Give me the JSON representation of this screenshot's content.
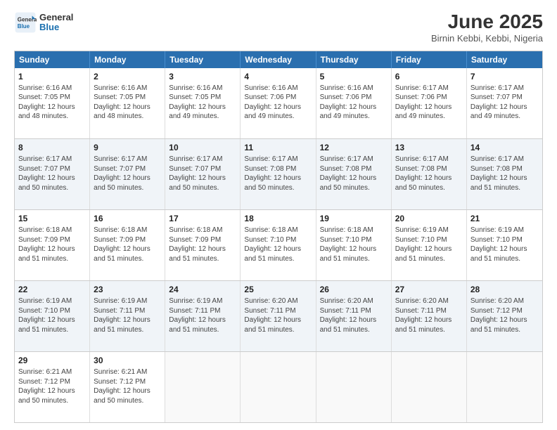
{
  "header": {
    "logo_line1": "General",
    "logo_line2": "Blue",
    "month": "June 2025",
    "location": "Birnin Kebbi, Kebbi, Nigeria"
  },
  "weekdays": [
    "Sunday",
    "Monday",
    "Tuesday",
    "Wednesday",
    "Thursday",
    "Friday",
    "Saturday"
  ],
  "rows": [
    [
      {
        "day": "1",
        "lines": [
          "Sunrise: 6:16 AM",
          "Sunset: 7:05 PM",
          "Daylight: 12 hours",
          "and 48 minutes."
        ]
      },
      {
        "day": "2",
        "lines": [
          "Sunrise: 6:16 AM",
          "Sunset: 7:05 PM",
          "Daylight: 12 hours",
          "and 48 minutes."
        ]
      },
      {
        "day": "3",
        "lines": [
          "Sunrise: 6:16 AM",
          "Sunset: 7:05 PM",
          "Daylight: 12 hours",
          "and 49 minutes."
        ]
      },
      {
        "day": "4",
        "lines": [
          "Sunrise: 6:16 AM",
          "Sunset: 7:06 PM",
          "Daylight: 12 hours",
          "and 49 minutes."
        ]
      },
      {
        "day": "5",
        "lines": [
          "Sunrise: 6:16 AM",
          "Sunset: 7:06 PM",
          "Daylight: 12 hours",
          "and 49 minutes."
        ]
      },
      {
        "day": "6",
        "lines": [
          "Sunrise: 6:17 AM",
          "Sunset: 7:06 PM",
          "Daylight: 12 hours",
          "and 49 minutes."
        ]
      },
      {
        "day": "7",
        "lines": [
          "Sunrise: 6:17 AM",
          "Sunset: 7:07 PM",
          "Daylight: 12 hours",
          "and 49 minutes."
        ]
      }
    ],
    [
      {
        "day": "8",
        "lines": [
          "Sunrise: 6:17 AM",
          "Sunset: 7:07 PM",
          "Daylight: 12 hours",
          "and 50 minutes."
        ]
      },
      {
        "day": "9",
        "lines": [
          "Sunrise: 6:17 AM",
          "Sunset: 7:07 PM",
          "Daylight: 12 hours",
          "and 50 minutes."
        ]
      },
      {
        "day": "10",
        "lines": [
          "Sunrise: 6:17 AM",
          "Sunset: 7:07 PM",
          "Daylight: 12 hours",
          "and 50 minutes."
        ]
      },
      {
        "day": "11",
        "lines": [
          "Sunrise: 6:17 AM",
          "Sunset: 7:08 PM",
          "Daylight: 12 hours",
          "and 50 minutes."
        ]
      },
      {
        "day": "12",
        "lines": [
          "Sunrise: 6:17 AM",
          "Sunset: 7:08 PM",
          "Daylight: 12 hours",
          "and 50 minutes."
        ]
      },
      {
        "day": "13",
        "lines": [
          "Sunrise: 6:17 AM",
          "Sunset: 7:08 PM",
          "Daylight: 12 hours",
          "and 50 minutes."
        ]
      },
      {
        "day": "14",
        "lines": [
          "Sunrise: 6:17 AM",
          "Sunset: 7:08 PM",
          "Daylight: 12 hours",
          "and 51 minutes."
        ]
      }
    ],
    [
      {
        "day": "15",
        "lines": [
          "Sunrise: 6:18 AM",
          "Sunset: 7:09 PM",
          "Daylight: 12 hours",
          "and 51 minutes."
        ]
      },
      {
        "day": "16",
        "lines": [
          "Sunrise: 6:18 AM",
          "Sunset: 7:09 PM",
          "Daylight: 12 hours",
          "and 51 minutes."
        ]
      },
      {
        "day": "17",
        "lines": [
          "Sunrise: 6:18 AM",
          "Sunset: 7:09 PM",
          "Daylight: 12 hours",
          "and 51 minutes."
        ]
      },
      {
        "day": "18",
        "lines": [
          "Sunrise: 6:18 AM",
          "Sunset: 7:10 PM",
          "Daylight: 12 hours",
          "and 51 minutes."
        ]
      },
      {
        "day": "19",
        "lines": [
          "Sunrise: 6:18 AM",
          "Sunset: 7:10 PM",
          "Daylight: 12 hours",
          "and 51 minutes."
        ]
      },
      {
        "day": "20",
        "lines": [
          "Sunrise: 6:19 AM",
          "Sunset: 7:10 PM",
          "Daylight: 12 hours",
          "and 51 minutes."
        ]
      },
      {
        "day": "21",
        "lines": [
          "Sunrise: 6:19 AM",
          "Sunset: 7:10 PM",
          "Daylight: 12 hours",
          "and 51 minutes."
        ]
      }
    ],
    [
      {
        "day": "22",
        "lines": [
          "Sunrise: 6:19 AM",
          "Sunset: 7:10 PM",
          "Daylight: 12 hours",
          "and 51 minutes."
        ]
      },
      {
        "day": "23",
        "lines": [
          "Sunrise: 6:19 AM",
          "Sunset: 7:11 PM",
          "Daylight: 12 hours",
          "and 51 minutes."
        ]
      },
      {
        "day": "24",
        "lines": [
          "Sunrise: 6:19 AM",
          "Sunset: 7:11 PM",
          "Daylight: 12 hours",
          "and 51 minutes."
        ]
      },
      {
        "day": "25",
        "lines": [
          "Sunrise: 6:20 AM",
          "Sunset: 7:11 PM",
          "Daylight: 12 hours",
          "and 51 minutes."
        ]
      },
      {
        "day": "26",
        "lines": [
          "Sunrise: 6:20 AM",
          "Sunset: 7:11 PM",
          "Daylight: 12 hours",
          "and 51 minutes."
        ]
      },
      {
        "day": "27",
        "lines": [
          "Sunrise: 6:20 AM",
          "Sunset: 7:11 PM",
          "Daylight: 12 hours",
          "and 51 minutes."
        ]
      },
      {
        "day": "28",
        "lines": [
          "Sunrise: 6:20 AM",
          "Sunset: 7:12 PM",
          "Daylight: 12 hours",
          "and 51 minutes."
        ]
      }
    ],
    [
      {
        "day": "29",
        "lines": [
          "Sunrise: 6:21 AM",
          "Sunset: 7:12 PM",
          "Daylight: 12 hours",
          "and 50 minutes."
        ]
      },
      {
        "day": "30",
        "lines": [
          "Sunrise: 6:21 AM",
          "Sunset: 7:12 PM",
          "Daylight: 12 hours",
          "and 50 minutes."
        ]
      },
      {
        "day": "",
        "lines": []
      },
      {
        "day": "",
        "lines": []
      },
      {
        "day": "",
        "lines": []
      },
      {
        "day": "",
        "lines": []
      },
      {
        "day": "",
        "lines": []
      }
    ]
  ]
}
